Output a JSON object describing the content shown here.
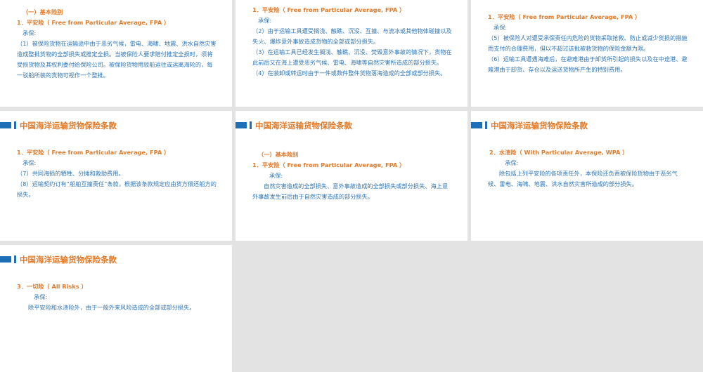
{
  "header_title": "中国海洋运输货物保险条款",
  "section_basic": "（一）基本险别",
  "fpa_heading": "1．平安险（ Free from Particular Average, FPA ）",
  "wpa_heading": "2．水渍险（ With Particular Average, WPA ）",
  "allrisk_heading": "3．一切险（ All Risks ）",
  "covers": "承保:",
  "slides": [
    {
      "paras": [
        "（1）被保险货物在运输途中由于恶劣气候，雷电、海啸、地震、洪水自然灾害造成整批货物的全部损失或推定全损。当被保险人要求赔付推定全损时，须将受损货物及其权利委付给保险公司。被保险货物用驳船运往或运离海轮的，每一驳船所装的货物可视作一个整批。"
      ]
    },
    {
      "paras": [
        "（2）由于运输工具遭受搁浅、触礁、沉没、互撞、与流冰或其他物体碰撞以及失火、爆炸意外事故造成货物的全部或部分损失。",
        "（3）在运输工具已经发生搁浅、触礁、沉没、焚毁意外事故的情况下，货物在此前后又在海上遭受恶劣气候、雷电、海啸等自然灾害所造成的部分损失。",
        "（4）在装卸或转运时由于一件或数件整件货物落海造成的全部或部分损失。"
      ]
    },
    {
      "paras": [
        "（5）被保险人对遭受承保责任内危险的货物采取抢救、防止或减少货损的措施而支付的合理费用，但以不超过该批被救货物的保险金额为限。",
        "（6）运输工具遭遇海难后，在避难港由于卸货所引起的损失以及在中途港、避难港由于卸货、存仓以及运送货物所产生的特别费用。"
      ]
    },
    {
      "paras": [
        "（7）共同海损的牺牲、分摊和救助费用。",
        "（8）运输契约订有“船舶互撞责任”条款，根据该条款规定应由货方偿还船方的损失。"
      ]
    },
    {
      "paras": [
        "自然灾害造成的全部损失、意外事故造成的全部损失或部分损失、海上意外事故发生前后由于自然灾害造成的部分损失。"
      ]
    },
    {
      "paras": [
        "除包括上列平安险的各项责任外，本保险还负责被保险货物由于恶劣气候、雷电、海啸、地震、洪水自然灾害所造成的部分损失。"
      ]
    },
    {
      "paras": [
        "除平安险和水渍险外，由于一般外来风险造成的全部或部分损失。"
      ]
    }
  ]
}
